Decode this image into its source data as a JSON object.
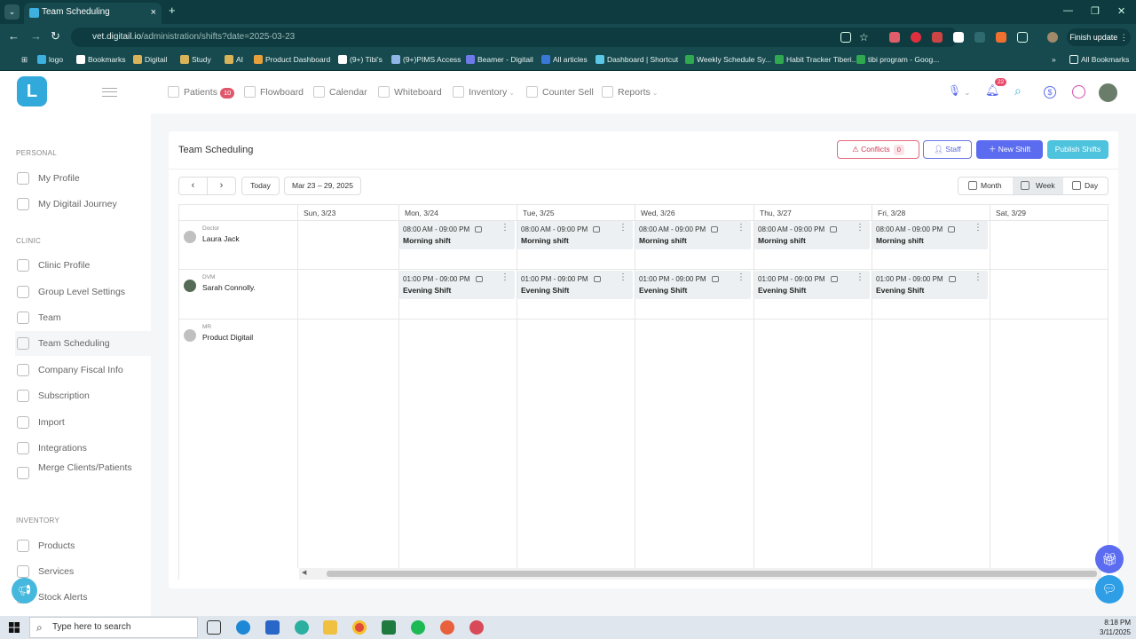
{
  "browser": {
    "tab_title": "Team Scheduling",
    "tab_close": "×",
    "new_tab": "+",
    "url_host": "vet.digitail.io",
    "url_path": "/administration/shifts?date=2025-03-23",
    "finish_update": "Finish update",
    "bookmarks": [
      {
        "label": "logo",
        "color": "#3db0e0"
      },
      {
        "label": "Bookmarks",
        "color": "#ffffff"
      },
      {
        "label": "Digitail",
        "color": "#d9b35a"
      },
      {
        "label": "Study",
        "color": "#d9b35a"
      },
      {
        "label": "AI",
        "color": "#d9b35a"
      },
      {
        "label": "Product Dashboard",
        "color": "#e8a03a"
      },
      {
        "label": "(9+) Tibi's",
        "color": "#ffffff"
      },
      {
        "label": "(9+)PIMS Access",
        "color": "#8fb6e6"
      },
      {
        "label": "Beamer - Digitail",
        "color": "#6e7ae8"
      },
      {
        "label": "All articles",
        "color": "#3a78d8"
      },
      {
        "label": "Dashboard | Shortcut",
        "color": "#5ac8e6"
      },
      {
        "label": "Weekly Schedule Sy...",
        "color": "#2fa84f"
      },
      {
        "label": "Habit Tracker Tiberi...",
        "color": "#2fa84f"
      },
      {
        "label": "tibi program - Goog...",
        "color": "#2fa84f"
      }
    ],
    "bookmarks_more": "»",
    "all_bookmarks": "All Bookmarks"
  },
  "sidebar": {
    "logo_letter": "L",
    "sections": [
      {
        "title": "PERSONAL",
        "items": [
          "My Profile",
          "My Digitail Journey"
        ]
      },
      {
        "title": "CLINIC",
        "items": [
          "Clinic Profile",
          "Group Level Settings",
          "Team",
          "Team Scheduling",
          "Company Fiscal Info",
          "Subscription",
          "Import",
          "Integrations",
          "Merge Clients/Patients"
        ]
      },
      {
        "title": "INVENTORY",
        "items": [
          "Products",
          "Services",
          "Stock Alerts"
        ]
      }
    ],
    "active": "Team Scheduling"
  },
  "topnav": {
    "items": [
      "Patients",
      "Flowboard",
      "Calendar",
      "Whiteboard",
      "Inventory",
      "Counter Sell",
      "Reports"
    ],
    "patients_badge": "10",
    "notif_badge": "22"
  },
  "page": {
    "title": "Team Scheduling",
    "conflicts_label": "Conflicts",
    "conflicts_count": "0",
    "staff_label": "Staff",
    "new_shift_label": "New Shift",
    "publish_label": "Publish Shifts",
    "today_label": "Today",
    "range_label": "Mar 23 – 29, 2025",
    "prev": "‹",
    "next": "›",
    "views": {
      "month": "Month",
      "week": "Week",
      "day": "Day"
    },
    "active_view": "Week"
  },
  "schedule": {
    "days": [
      "Sun, 3/23",
      "Mon, 3/24",
      "Tue, 3/25",
      "Wed, 3/26",
      "Thu, 3/27",
      "Fri, 3/28",
      "Sat, 3/29"
    ],
    "staff": [
      {
        "role": "Doctor",
        "name": "Laura Jack"
      },
      {
        "role": "DVM",
        "name": "Sarah Connolly."
      },
      {
        "role": "MR",
        "name": "Product Digitail"
      }
    ],
    "shift_types": {
      "morning": {
        "time": "08:00 AM - 09:00 PM",
        "name": "Morning shift"
      },
      "evening": {
        "time": "01:00 PM - 09:00 PM",
        "name": "Evening Shift"
      }
    },
    "dots": "⋮"
  },
  "taskbar": {
    "search_placeholder": "Type here to search",
    "time": "8:18 PM",
    "date": "3/11/2025"
  }
}
